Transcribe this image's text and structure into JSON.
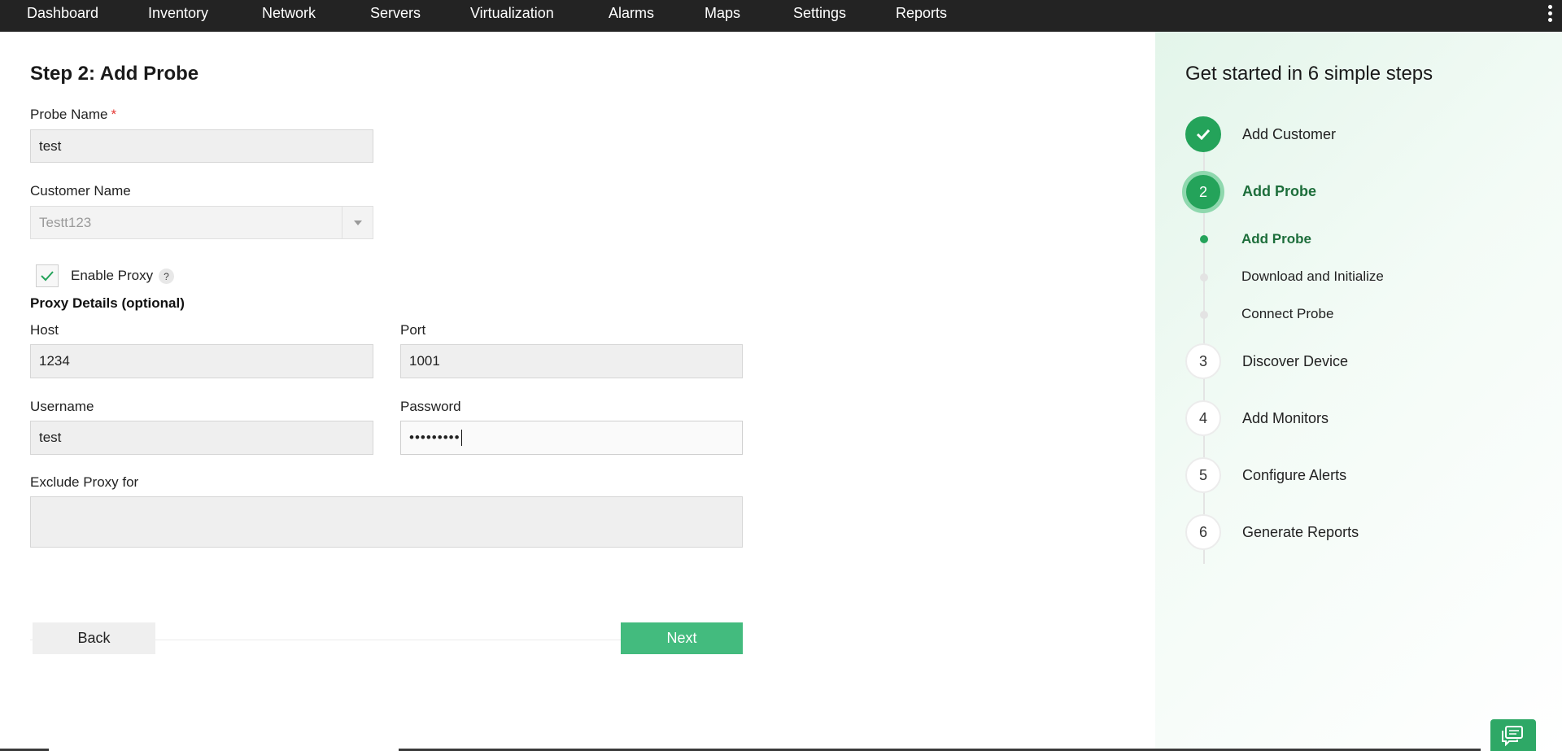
{
  "nav": {
    "items": [
      "Dashboard",
      "Inventory",
      "Network",
      "Servers",
      "Virtualization",
      "Alarms",
      "Maps",
      "Settings",
      "Reports"
    ],
    "more_icon": "kebab-menu-icon"
  },
  "form": {
    "title": "Step 2: Add Probe",
    "probe_name_label": "Probe Name",
    "required_mark": "*",
    "probe_name_value": "test",
    "customer_name_label": "Customer Name",
    "customer_name_value": "Testt123",
    "enable_proxy_label": "Enable Proxy",
    "enable_proxy_checked": true,
    "help_mark": "?",
    "proxy_section_title": "Proxy Details (optional)",
    "host_label": "Host",
    "host_value": "1234",
    "port_label": "Port",
    "port_value": "1001",
    "username_label": "Username",
    "username_value": "test",
    "password_label": "Password",
    "password_value": "•••••••••",
    "exclude_label": "Exclude Proxy for",
    "exclude_value": "",
    "back_label": "Back",
    "next_label": "Next"
  },
  "steps_panel": {
    "title": "Get started in 6 simple steps",
    "steps": [
      {
        "number": "",
        "label": "Add Customer",
        "state": "done"
      },
      {
        "number": "2",
        "label": "Add Probe",
        "state": "active"
      },
      {
        "number": "3",
        "label": "Discover Device",
        "state": "pending"
      },
      {
        "number": "4",
        "label": "Add Monitors",
        "state": "pending"
      },
      {
        "number": "5",
        "label": "Configure Alerts",
        "state": "pending"
      },
      {
        "number": "6",
        "label": "Generate Reports",
        "state": "pending"
      }
    ],
    "substeps": [
      {
        "label": "Add Probe",
        "state": "active"
      },
      {
        "label": "Download and Initialize",
        "state": "pending"
      },
      {
        "label": "Connect Probe",
        "state": "pending"
      }
    ]
  },
  "colors": {
    "nav_bg": "#232323",
    "accent_green": "#24a35a",
    "button_green": "#43bb7e",
    "required_red": "#e53935"
  }
}
